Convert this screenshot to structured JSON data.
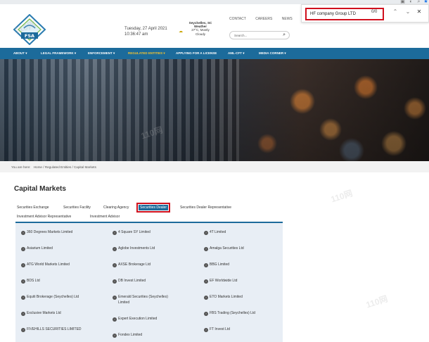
{
  "header": {
    "logo_text": "FSA",
    "date": "Tuesday, 27 April 2021",
    "time": "10:36:47 am",
    "weather_title_line1": "Seychelles, SC",
    "weather_title_line2": "Weather",
    "weather_temp": "27°C, Mostly",
    "weather_cond": "Cloudy",
    "links": [
      "CONTACT",
      "CAREERS",
      "NEWS"
    ],
    "search_placeholder": "Search..."
  },
  "find_bar": {
    "query": "HF company Group LTD",
    "count": "0/0"
  },
  "nav": {
    "items": [
      "ABOUT ▾",
      "LEGAL FRAMEWORK ▾",
      "ENFORCEMENT ▾",
      "REGULATED ENTITIES ▾",
      "APPLYING FOR A LICENSE",
      "AML-CFT ▾",
      "MEDIA CORNER ▾"
    ],
    "active_index": 3
  },
  "breadcrumb": {
    "prefix": "You are here:",
    "items": [
      "Home",
      "Regulated Entities",
      "Capital Markets"
    ]
  },
  "main": {
    "title": "Capital Markets",
    "tabs": [
      "Securities Exchange",
      "Securities Facility",
      "Clearing Agency",
      "Securities Dealer",
      "Securities Dealer Representative",
      "Investment Advisor Representative",
      "Investment Advisor"
    ],
    "active_tab": "Securities Dealer",
    "entities_col1": [
      "360 Degrees Markets Limited",
      "Asiarium Limited",
      "ATG World Markets Limited",
      "BDS Ltd",
      "Equiti Brokerage (Seychelles) Ltd",
      "Exclusive Markets Ltd",
      "FIVEHILLS SECURITIES LIMITED"
    ],
    "entities_col2": [
      "4 Square SY Limited",
      "Aglobe Investments Ltd",
      "AXSE Brokerage Ltd",
      "DB Invest Limited",
      "Emerald Securities (Seychelles)",
      "Limited",
      "Expert Execution Limited",
      "Fondex Limited"
    ],
    "entities_col3": [
      "4T Limited",
      "Amalga Securities Ltd",
      "BBG Limited",
      "EF Worldwide Ltd",
      "ETO Markets Limited",
      "FBS Trading (Seychelles) Ltd",
      "FT Invest Ltd"
    ]
  },
  "watermark_text": "110网",
  "colors": {
    "nav_bg": "#1c6b9b",
    "nav_active": "#f3c331",
    "highlight": "#d0101d"
  }
}
